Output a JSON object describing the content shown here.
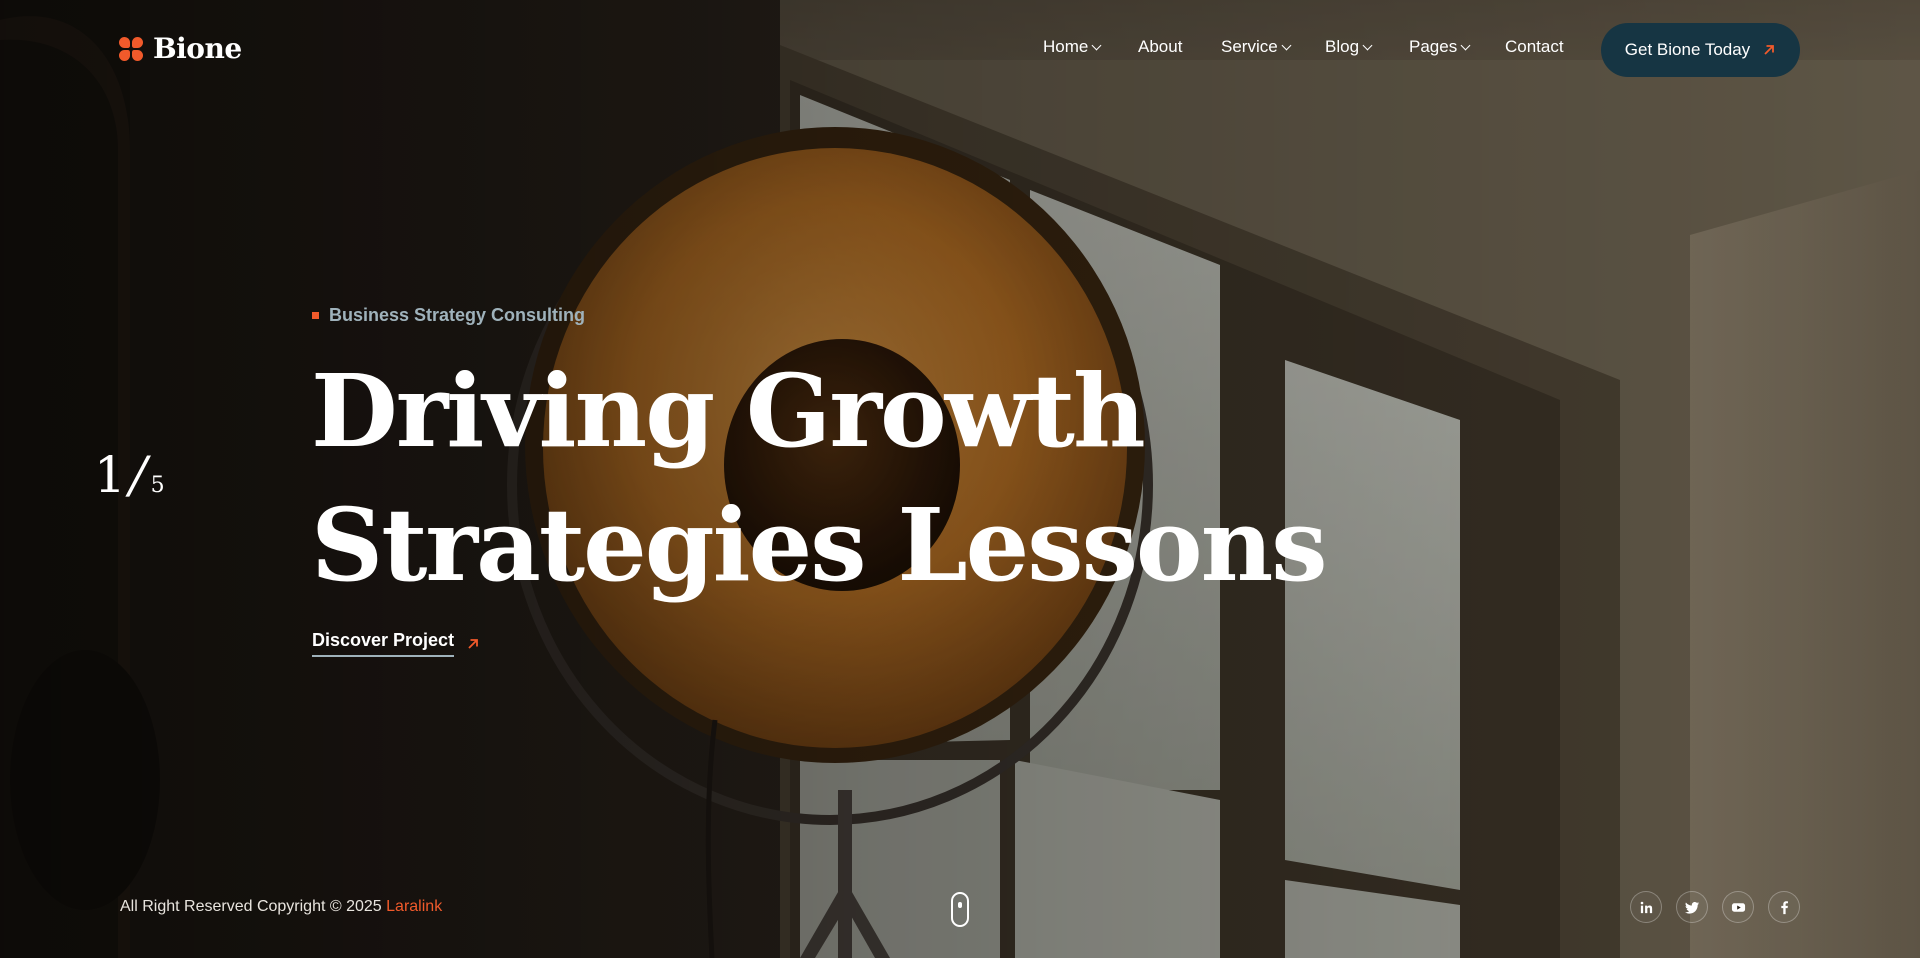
{
  "brand": {
    "name": "Bione"
  },
  "nav": {
    "items": [
      {
        "label": "Home",
        "has_dropdown": true
      },
      {
        "label": "About",
        "has_dropdown": false
      },
      {
        "label": "Service",
        "has_dropdown": true
      },
      {
        "label": "Blog",
        "has_dropdown": true
      },
      {
        "label": "Pages",
        "has_dropdown": true
      },
      {
        "label": "Contact",
        "has_dropdown": false
      }
    ],
    "cta_label": "Get Bione Today"
  },
  "slider": {
    "current": "1",
    "separator": "/",
    "total": "5"
  },
  "hero": {
    "eyebrow": "Business Strategy Consulting",
    "title_line1": "Driving Growth",
    "title_line2": "Strategies Lessons",
    "link_label": "Discover Project"
  },
  "footer": {
    "copyright_prefix": "All Right Reserved Copyright © 2025",
    "copyright_brand": "Laralink",
    "socials": [
      {
        "icon": "linkedin-icon"
      },
      {
        "icon": "twitter-icon"
      },
      {
        "icon": "youtube-icon"
      },
      {
        "icon": "facebook-icon"
      }
    ]
  },
  "colors": {
    "accent": "#f15a2b",
    "cta_bg": "#163543",
    "eyebrow": "#9fb2bb"
  }
}
